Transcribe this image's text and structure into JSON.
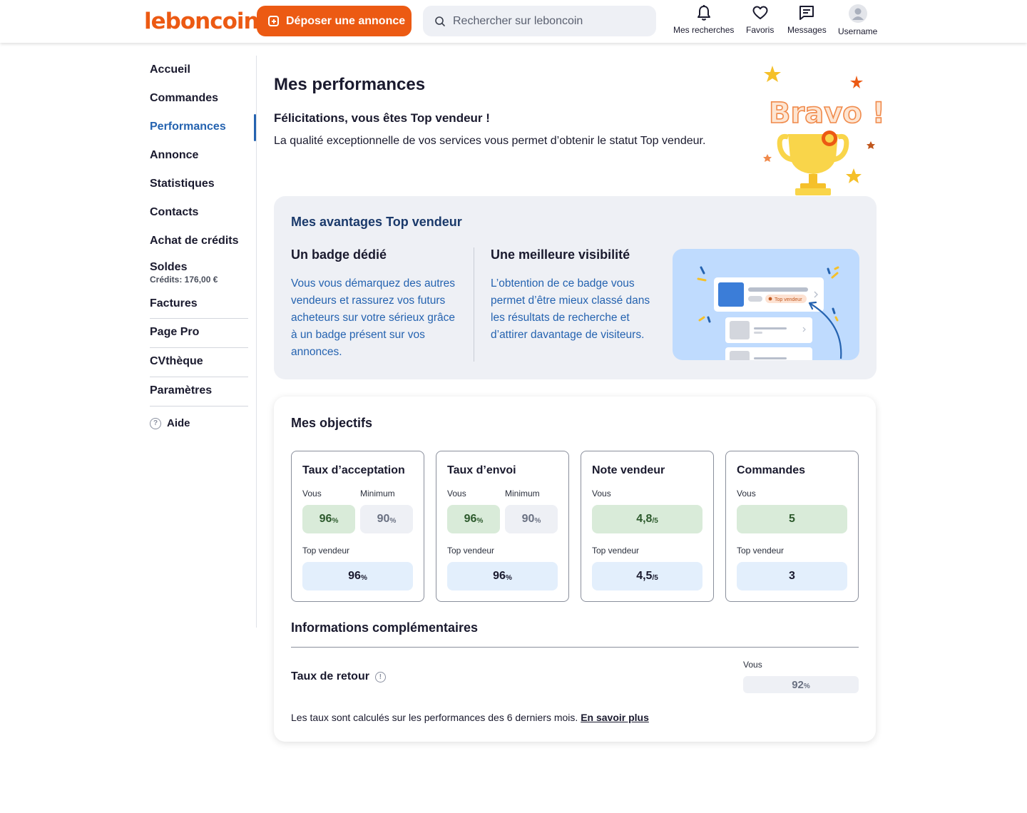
{
  "header": {
    "logo": "leboncoin",
    "deposit_label": "Déposer une annonce",
    "search_placeholder": "Rechercher sur leboncoin",
    "nav": [
      {
        "label": "Mes recherches",
        "icon": "bell-icon"
      },
      {
        "label": "Favoris",
        "icon": "heart-icon"
      },
      {
        "label": "Messages",
        "icon": "message-icon"
      },
      {
        "label": "Username",
        "icon": "avatar-icon"
      }
    ]
  },
  "sidebar": {
    "items": [
      {
        "label": "Accueil"
      },
      {
        "label": "Commandes"
      },
      {
        "label": "Performances",
        "active": true
      },
      {
        "label": "Annonce"
      },
      {
        "label": "Statistiques"
      },
      {
        "label": "Contacts"
      },
      {
        "label": "Achat de crédits"
      },
      {
        "label": "Soldes",
        "sub": "Crédits: 176,00 €"
      },
      {
        "label": "Factures"
      },
      {
        "label": "Page Pro"
      },
      {
        "label": "CVthèque"
      },
      {
        "label": "Paramètres"
      }
    ],
    "help": "Aide"
  },
  "main": {
    "title": "Mes performances",
    "congrats_title": "Félicitations, vous êtes Top vendeur !",
    "congrats_desc": "La qualité exceptionnelle de vos services vous permet d’obtenir le statut  Top vendeur.",
    "bravo": "Bravo !",
    "advantages": {
      "title": "Mes avantages Top vendeur",
      "col1_title": "Un badge dédié",
      "col1_text": "Vous vous démarquez des autres vendeurs et rassurez vos futurs acheteurs sur votre sérieux grâce à un badge présent sur vos annonces.",
      "col2_title": "Une meilleure visibilité",
      "col2_text": "L’obtention de ce badge vous permet d’être mieux classé dans les résultats de recherche et d’attirer davantage de visiteurs.",
      "illus_badge": "Top vendeur"
    },
    "objectives": {
      "title": "Mes objectifs",
      "label_vous": "Vous",
      "label_min": "Minimum",
      "label_top": "Top vendeur",
      "metrics": [
        {
          "name": "Taux d’acceptation",
          "vous": "96",
          "min": "90",
          "top": "96",
          "unit": "%"
        },
        {
          "name": "Taux d’envoi",
          "vous": "96",
          "min": "90",
          "top": "96",
          "unit": "%"
        },
        {
          "name": "Note vendeur",
          "vous": "4,8",
          "top": "4,5",
          "unit": "/5"
        },
        {
          "name": "Commandes",
          "vous": "5",
          "top": "3",
          "unit": ""
        }
      ],
      "info_title": "Informations complémentaires",
      "retour_label": "Taux de retour",
      "retour_vous": "Vous",
      "retour_value": "92",
      "retour_unit": "%",
      "footnote": "Les taux sont calculés sur les performances des 6 derniers mois.",
      "footnote_link": "En savoir plus"
    }
  },
  "colors": {
    "brand": "#ec5a13",
    "active": "#2563b0",
    "advantage_text": "#2563b0"
  }
}
